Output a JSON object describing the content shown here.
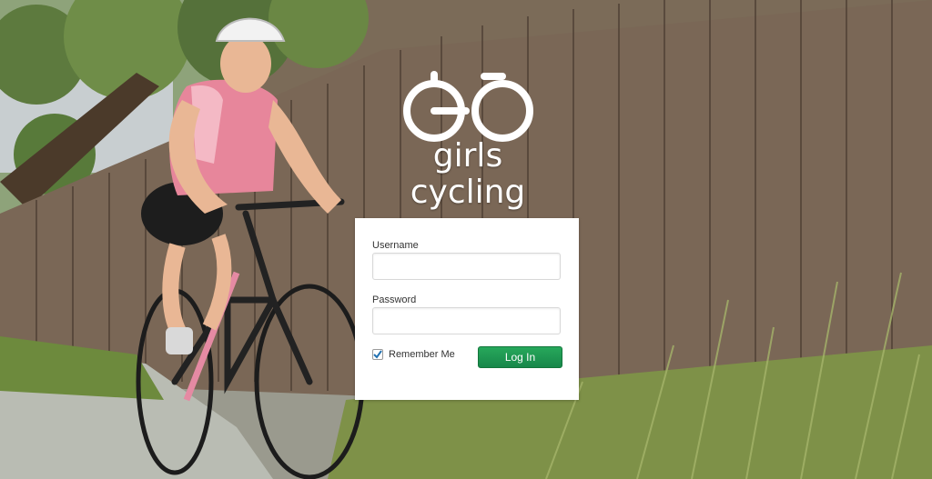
{
  "brand": {
    "logo_text": "girls cycling",
    "logo_icon": "bicycle-go-logo-icon"
  },
  "background": {
    "icon": "cyclist-photo-background"
  },
  "login": {
    "username_label": "Username",
    "username_value": "",
    "password_label": "Password",
    "password_value": "",
    "remember_label": "Remember Me",
    "remember_checked": true,
    "button_label": "Log In"
  },
  "colors": {
    "button_green": "#1f9a55",
    "checkbox_check": "#2271b1",
    "panel_bg": "#ffffff"
  }
}
